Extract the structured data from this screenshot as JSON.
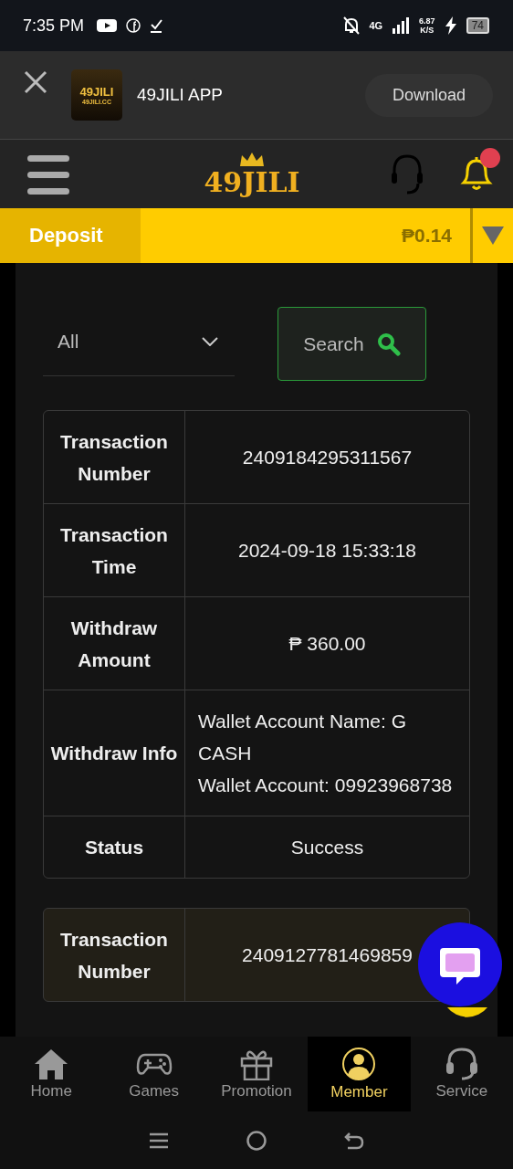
{
  "status_bar": {
    "time": "7:35 PM",
    "network": "4G",
    "speed": "6.87",
    "speed_unit": "K/S",
    "battery": "74"
  },
  "app_banner": {
    "icon_title": "49JILI",
    "icon_subtitle": "49JILI.CC",
    "name": "49JILI APP",
    "button": "Download"
  },
  "header": {
    "logo": "49JILI",
    "notification_badge": true
  },
  "balance_bar": {
    "deposit": "Deposit",
    "balance": "₱0.14"
  },
  "filter": {
    "type": "All",
    "search": "Search"
  },
  "transactions": [
    {
      "highlighted": false,
      "fields": [
        {
          "label": "Transaction Number",
          "lines": [
            "2409184295311567"
          ]
        },
        {
          "label": "Transaction Time",
          "lines": [
            "2024-09-18 15:33:18"
          ]
        },
        {
          "label": "Withdraw Amount",
          "lines": [
            "₱ 360.00"
          ]
        },
        {
          "label": "Withdraw Info",
          "lines": [
            "Wallet Account Name: G CASH",
            "Wallet Account: 09923968738"
          ]
        },
        {
          "label": "Status",
          "lines": [
            "Success"
          ]
        }
      ]
    },
    {
      "highlighted": true,
      "fields": [
        {
          "label": "Transaction Number",
          "lines": [
            "2409127781469859"
          ]
        }
      ]
    }
  ],
  "bottom_nav": [
    {
      "kind": "home",
      "label": "Home",
      "selected": false
    },
    {
      "kind": "games",
      "label": "Games",
      "selected": false
    },
    {
      "kind": "promotion",
      "label": "Promotion",
      "selected": false
    },
    {
      "kind": "member",
      "label": "Member",
      "selected": true
    },
    {
      "kind": "service",
      "label": "Service",
      "selected": false
    }
  ]
}
